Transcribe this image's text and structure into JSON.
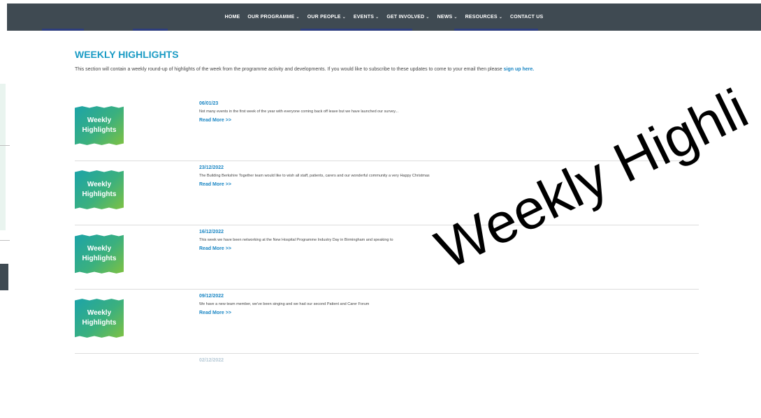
{
  "nav": {
    "items": [
      {
        "label": "HOME",
        "dropdown": false
      },
      {
        "label": "OUR PROGRAMME",
        "dropdown": true
      },
      {
        "label": "OUR PEOPLE",
        "dropdown": true
      },
      {
        "label": "EVENTS",
        "dropdown": true
      },
      {
        "label": "GET INVOLVED",
        "dropdown": true
      },
      {
        "label": "NEWS",
        "dropdown": true
      },
      {
        "label": "RESOURCES",
        "dropdown": true
      },
      {
        "label": "CONTACT US",
        "dropdown": false
      }
    ],
    "chevron": "⌄"
  },
  "page": {
    "title": "WEEKLY HIGHLIGHTS",
    "intro": "This section will contain a weekly round-up of highlights of the week from the programme activity and developments. If you would like to subscribe to these updates to come to your email then please ",
    "intro_link": "sign up here."
  },
  "thumb": {
    "line1": "Weekly",
    "line2": "Highlights"
  },
  "posts": [
    {
      "date": "06/01/23",
      "excerpt": "Not many events in the first week of the year with everyone coming back off leave but we have launched our survey...",
      "more": "Read More >>"
    },
    {
      "date": "23/12/2022",
      "excerpt": "The Building Berkshire Together team would like to wish all staff, patients, carers and our wonderful community a very Happy Christmas",
      "more": "Read More >>"
    },
    {
      "date": "16/12/2022",
      "excerpt": "This week we have been networking at the New Hospital Programme Industry Day in Birmingham and speaking to",
      "more": "Read More >>"
    },
    {
      "date": "09/12/2022",
      "excerpt": "We have a new team member, we've been singing and we had our second Patient and Carer Forum",
      "more": "Read More >>"
    },
    {
      "date": "02/12/2022",
      "excerpt": "",
      "more": ""
    }
  ],
  "watermark": "Weekly Highli",
  "colors": {
    "nav_bg": "#3f4a52",
    "accent": "#1a9bc4",
    "link": "#1a86c4",
    "thumb_from": "#1ba3a9",
    "thumb_to": "#7fc241"
  }
}
